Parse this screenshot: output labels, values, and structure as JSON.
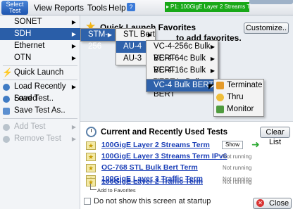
{
  "toolbar": {
    "select_test_label": "Select Test",
    "menus": [
      "View",
      "Reports",
      "Tools",
      "Help"
    ],
    "status_text": "P1: 100GigE Layer 2 Streams Term"
  },
  "left_panel": {
    "items": [
      {
        "label": "SONET",
        "icon": "none"
      },
      {
        "label": "SDH",
        "icon": "none"
      },
      {
        "label": "Ethernet",
        "icon": "none"
      },
      {
        "label": "OTN",
        "icon": "none"
      },
      {
        "label": "Quick Launch",
        "icon": "lightning-icon"
      },
      {
        "label": "Load Recently Saved",
        "icon": "load-icon"
      },
      {
        "label": "Load Test..",
        "icon": "load-icon"
      },
      {
        "label": "Save Test As..",
        "icon": "save-icon"
      },
      {
        "label": "Add Test",
        "icon": "add-icon"
      },
      {
        "label": "Remove Test",
        "icon": "remove-icon"
      }
    ]
  },
  "submenu1": {
    "items": [
      "STM-256"
    ]
  },
  "submenu2": {
    "items": [
      "STL Bert",
      "AU-4",
      "AU-3"
    ]
  },
  "submenu3": {
    "items": [
      "VC-4-256c Bulk BERT",
      "VC-4-64c Bulk BERT",
      "VC-4-16c Bulk BERT",
      "VC-4-4c Bulk BERT",
      "VC-4 Bulk BERT"
    ]
  },
  "submenu4": {
    "items": [
      "Terminate",
      "Thru",
      "Monitor"
    ]
  },
  "quick_launch": {
    "title": "Quick Launch Favorites",
    "hint": "to add favorites.",
    "customize_label": "Customize.."
  },
  "recent": {
    "title": "Current and Recently Used Tests",
    "clear_label": "Clear List",
    "rows": [
      {
        "name": "100GigE Layer 2 Streams Term",
        "status": "Show"
      },
      {
        "name": "100GigE Layer 3 Streams Term IPv6",
        "status": "Not running"
      },
      {
        "name": "OC-768 STL Bulk Bert Term",
        "status": "Not running"
      },
      {
        "name": "100GigE Layer 3 Traffic Term",
        "status": "Not running"
      },
      {
        "name": "100GigE Layer 2 Traffic Term",
        "status": "Not running"
      }
    ],
    "add_favorites_label": "Add to Favorites"
  },
  "footer": {
    "dont_show_label": "Do not show this screen at startup",
    "close_label": "Close"
  },
  "colors": {
    "accent": "#2f62ab",
    "status_green": "#18a818",
    "link": "#1b3fb7"
  }
}
